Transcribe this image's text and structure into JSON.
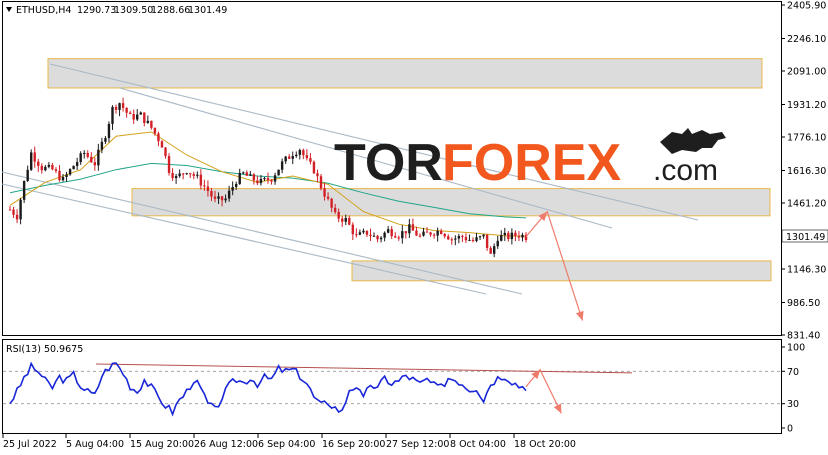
{
  "symbol_header": {
    "symbol": "ETHUSD,H4",
    "open": "1290.73",
    "high": "1309.50",
    "low": "1288.66",
    "close": "1301.49"
  },
  "watermark": {
    "part1": "TOR",
    "part2": "FOREX",
    "part3": ".com",
    "color_dark": "#1e1e1e",
    "color_accent": "#f2571d"
  },
  "colors": {
    "bull_candle": "#1a1a1a",
    "bear_candle": "#d31f26",
    "ma_fast": "#d4a017",
    "ma_slow": "#21a589",
    "channel_line": "#a9b9c6",
    "zone_fill": "#dcdcdc",
    "zone_border": "#e8b84a",
    "forecast_arrow": "#f07b6c",
    "rsi_line": "#1826d8",
    "rsi_trend": "#b5514d"
  },
  "chart_data": [
    {
      "type": "candlestick",
      "title": "ETHUSD,H4",
      "y_ticks": [
        "2405.90",
        "2246.10",
        "2091.00",
        "1931.20",
        "1776.10",
        "1616.30",
        "1461.20",
        "1146.30",
        "986.50",
        "831.40"
      ],
      "y_range": [
        831.4,
        2405.9
      ],
      "current_price_label": "1301.49",
      "x_labels": [
        "25 Jul 2022",
        "5 Aug 04:00",
        "15 Aug 20:00",
        "26 Aug 12:00",
        "6 Sep 04:00",
        "16 Sep 20:00",
        "27 Sep 12:00",
        "8 Oct 04:00",
        "18 Oct 20:00"
      ],
      "price_path": [
        [
          0,
          1430
        ],
        [
          2,
          1400
        ],
        [
          4,
          1560
        ],
        [
          6,
          1700
        ],
        [
          9,
          1630
        ],
        [
          12,
          1620
        ],
        [
          15,
          1570
        ],
        [
          18,
          1640
        ],
        [
          21,
          1700
        ],
        [
          24,
          1650
        ],
        [
          27,
          1790
        ],
        [
          29,
          1910
        ],
        [
          31,
          1940
        ],
        [
          34,
          1870
        ],
        [
          37,
          1880
        ],
        [
          40,
          1820
        ],
        [
          43,
          1740
        ],
        [
          45,
          1620
        ],
        [
          47,
          1580
        ],
        [
          50,
          1620
        ],
        [
          53,
          1580
        ],
        [
          56,
          1520
        ],
        [
          58,
          1470
        ],
        [
          61,
          1480
        ],
        [
          64,
          1570
        ],
        [
          66,
          1600
        ],
        [
          68,
          1580
        ],
        [
          71,
          1560
        ],
        [
          74,
          1580
        ],
        [
          77,
          1650
        ],
        [
          80,
          1700
        ],
        [
          82,
          1720
        ],
        [
          84,
          1660
        ],
        [
          86,
          1620
        ],
        [
          88,
          1540
        ],
        [
          90,
          1470
        ],
        [
          92,
          1400
        ],
        [
          95,
          1380
        ],
        [
          98,
          1300
        ],
        [
          101,
          1320
        ],
        [
          104,
          1290
        ],
        [
          107,
          1330
        ],
        [
          110,
          1310
        ],
        [
          113,
          1340
        ],
        [
          116,
          1300
        ],
        [
          119,
          1320
        ],
        [
          122,
          1330
        ],
        [
          125,
          1290
        ],
        [
          128,
          1300
        ],
        [
          131,
          1280
        ],
        [
          134,
          1300
        ],
        [
          136,
          1210
        ],
        [
          138,
          1300
        ],
        [
          141,
          1300
        ],
        [
          144,
          1310
        ],
        [
          146,
          1301
        ]
      ],
      "ma_fast": [
        [
          0,
          1450
        ],
        [
          10,
          1560
        ],
        [
          20,
          1620
        ],
        [
          30,
          1780
        ],
        [
          40,
          1800
        ],
        [
          50,
          1690
        ],
        [
          60,
          1610
        ],
        [
          70,
          1560
        ],
        [
          80,
          1590
        ],
        [
          90,
          1550
        ],
        [
          100,
          1420
        ],
        [
          110,
          1360
        ],
        [
          120,
          1330
        ],
        [
          130,
          1320
        ],
        [
          140,
          1305
        ],
        [
          146,
          1303
        ]
      ],
      "ma_slow": [
        [
          0,
          1510
        ],
        [
          10,
          1545
        ],
        [
          20,
          1575
        ],
        [
          30,
          1620
        ],
        [
          40,
          1650
        ],
        [
          50,
          1640
        ],
        [
          60,
          1610
        ],
        [
          70,
          1590
        ],
        [
          80,
          1580
        ],
        [
          90,
          1555
        ],
        [
          100,
          1510
        ],
        [
          110,
          1470
        ],
        [
          120,
          1440
        ],
        [
          130,
          1410
        ],
        [
          140,
          1395
        ],
        [
          146,
          1390
        ]
      ],
      "zones": [
        {
          "from": 2010,
          "to": 2150
        },
        {
          "from": 1400,
          "to": 1530
        },
        {
          "from": 1090,
          "to": 1185
        }
      ],
      "forecast": [
        [
          146,
          1301
        ],
        [
          152,
          1420
        ],
        [
          162,
          900
        ]
      ]
    },
    {
      "type": "line",
      "title": "RSI(13) 50.9675",
      "series_name": "RSI(13)",
      "current_value": "50.9675",
      "y_ticks": [
        "100",
        "70",
        "30",
        "0"
      ],
      "y_range": [
        0,
        100
      ],
      "levels": [
        70,
        30
      ],
      "trendline": [
        [
          30,
          79
        ],
        [
          180,
          68
        ]
      ],
      "values_path": [
        [
          0,
          32
        ],
        [
          2,
          45
        ],
        [
          4,
          62
        ],
        [
          6,
          75
        ],
        [
          8,
          70
        ],
        [
          10,
          58
        ],
        [
          12,
          50
        ],
        [
          14,
          63
        ],
        [
          16,
          58
        ],
        [
          18,
          66
        ],
        [
          20,
          52
        ],
        [
          22,
          45
        ],
        [
          24,
          40
        ],
        [
          26,
          65
        ],
        [
          28,
          75
        ],
        [
          30,
          80
        ],
        [
          32,
          68
        ],
        [
          34,
          52
        ],
        [
          36,
          45
        ],
        [
          38,
          60
        ],
        [
          40,
          50
        ],
        [
          42,
          38
        ],
        [
          44,
          28
        ],
        [
          46,
          20
        ],
        [
          48,
          35
        ],
        [
          50,
          45
        ],
        [
          52,
          60
        ],
        [
          54,
          48
        ],
        [
          56,
          30
        ],
        [
          58,
          22
        ],
        [
          60,
          38
        ],
        [
          62,
          52
        ],
        [
          64,
          60
        ],
        [
          66,
          56
        ],
        [
          68,
          62
        ],
        [
          70,
          55
        ],
        [
          72,
          62
        ],
        [
          74,
          60
        ],
        [
          76,
          73
        ],
        [
          78,
          70
        ],
        [
          80,
          72
        ],
        [
          82,
          65
        ],
        [
          84,
          55
        ],
        [
          86,
          38
        ],
        [
          88,
          28
        ],
        [
          90,
          32
        ],
        [
          92,
          25
        ],
        [
          94,
          20
        ],
        [
          96,
          48
        ],
        [
          98,
          52
        ],
        [
          100,
          35
        ],
        [
          102,
          55
        ],
        [
          104,
          48
        ],
        [
          106,
          62
        ],
        [
          108,
          55
        ],
        [
          110,
          58
        ],
        [
          112,
          65
        ],
        [
          114,
          60
        ],
        [
          116,
          54
        ],
        [
          118,
          60
        ],
        [
          120,
          52
        ],
        [
          122,
          50
        ],
        [
          124,
          62
        ],
        [
          126,
          60
        ],
        [
          128,
          55
        ],
        [
          130,
          48
        ],
        [
          132,
          50
        ],
        [
          134,
          35
        ],
        [
          136,
          55
        ],
        [
          138,
          62
        ],
        [
          140,
          65
        ],
        [
          142,
          58
        ],
        [
          144,
          52
        ],
        [
          146,
          51
        ]
      ],
      "forecast": [
        [
          146,
          51
        ],
        [
          150,
          72
        ],
        [
          156,
          18
        ]
      ]
    }
  ]
}
